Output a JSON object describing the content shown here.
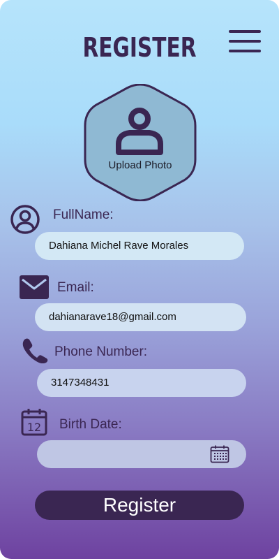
{
  "header": {
    "title": "REGISTER"
  },
  "photo": {
    "label": "Upload Photo"
  },
  "fields": {
    "fullname": {
      "label": "FullName:",
      "value": "Dahiana Michel Rave Morales"
    },
    "email": {
      "label": "Email:",
      "value": "dahianarave18@gmail.com"
    },
    "phone": {
      "label": "Phone Number:",
      "value": "3147348431"
    },
    "birthdate": {
      "label": "Birth Date:",
      "value": "",
      "calendar_day": "12"
    }
  },
  "actions": {
    "register_label": "Register"
  },
  "icons": {
    "menu": "hamburger-menu-icon",
    "photo": "user-silhouette-icon",
    "fullname": "user-circle-icon",
    "email": "envelope-icon",
    "phone": "phone-handset-icon",
    "birthdate": "calendar-icon",
    "date_picker": "calendar-grid-icon"
  },
  "colors": {
    "primary": "#3a2652",
    "photo_fill": "#8fb9d3",
    "input_light": "#d3e8f5",
    "input_muted": "#c2cae6"
  }
}
